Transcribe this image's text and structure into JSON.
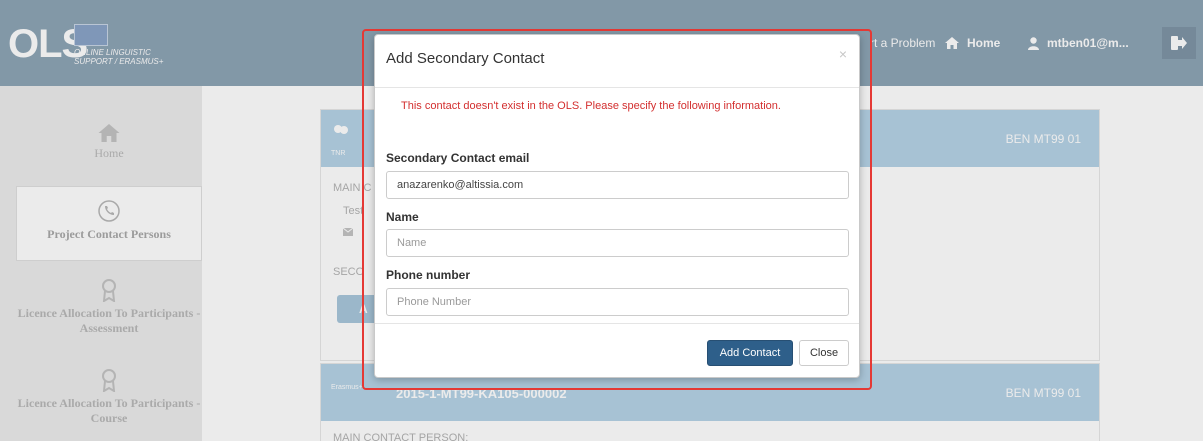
{
  "header": {
    "logo_text": "OLS",
    "logo_subtitle": "ONLINE LINGUISTIC SUPPORT / Erasmus+",
    "report_link": "rt a Problem",
    "home_label": "Home",
    "user_label": "mtben01@m..."
  },
  "sidebar": {
    "items": [
      {
        "label": "Home",
        "icon": "home-icon"
      },
      {
        "label": "Project Contact Persons",
        "icon": "phone-icon",
        "active": true
      },
      {
        "label": "Licence Allocation To Participants - Assessment",
        "icon": "award-icon"
      },
      {
        "label": "Licence Allocation To Participants - Course",
        "icon": "award-icon"
      }
    ]
  },
  "main": {
    "card1": {
      "badge": "TNR",
      "ben": "BEN MT99 01",
      "main_contact": "MAIN C",
      "test_text": "Test",
      "secondary": "SECO",
      "add_btn": "A"
    },
    "card2": {
      "badge": "Erasmus+",
      "project_id": "2015-1-MT99-KA105-000002",
      "ben": "BEN MT99 01",
      "main_contact": "MAIN CONTACT PERSON:"
    }
  },
  "modal": {
    "title": "Add Secondary Contact",
    "close_symbol": "×",
    "warning": "This contact doesn't exist in the OLS. Please specify the following information.",
    "email_label": "Secondary Contact email",
    "email_value": "anazarenko@altissia.com",
    "name_label": "Name",
    "name_placeholder": "Name",
    "phone_label": "Phone number",
    "phone_placeholder": "Phone Number",
    "add_button": "Add Contact",
    "close_button": "Close"
  },
  "colors": {
    "header_bg": "#8ea5b6",
    "card_header_bg": "#b6d3e6",
    "primary_button": "#2e5f8a",
    "warning_text": "#d32f2f",
    "highlight_border": "#e53935"
  }
}
